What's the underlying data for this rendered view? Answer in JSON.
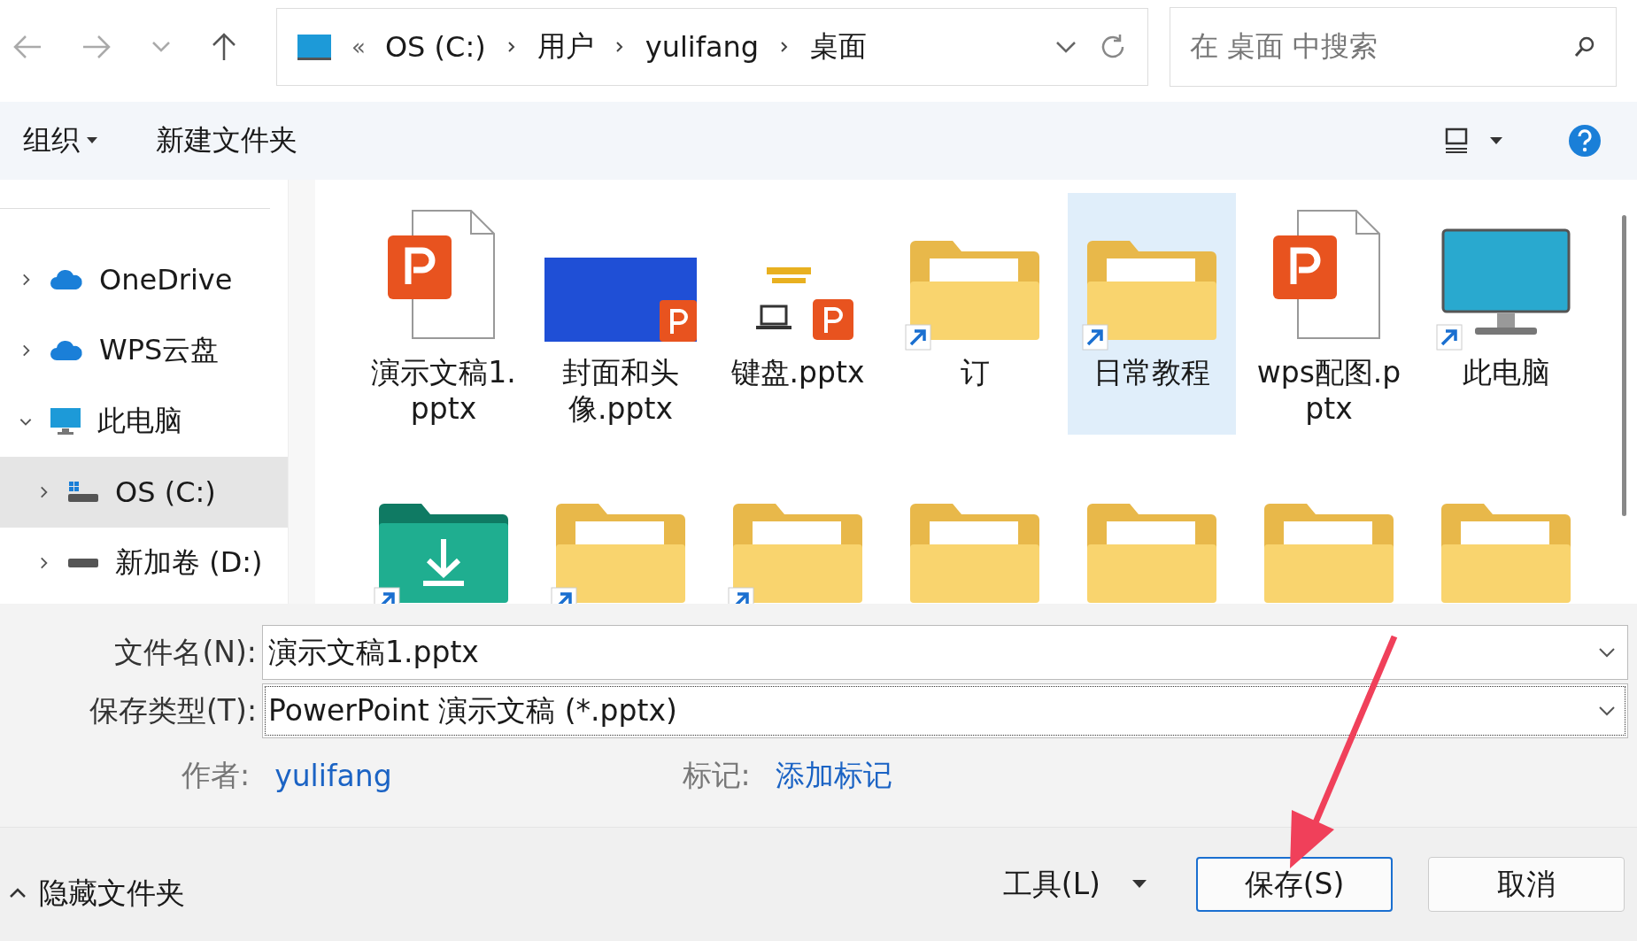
{
  "address_bar": {
    "overflow": "«",
    "segments": [
      "OS (C:)",
      "用户",
      "yulifang",
      "桌面"
    ]
  },
  "search": {
    "placeholder": "在 桌面 中搜索"
  },
  "toolbar": {
    "organize": "组织",
    "new_folder": "新建文件夹"
  },
  "sidebar": {
    "items": [
      {
        "name": "OneDrive",
        "kind": "cloud",
        "expanded": false,
        "selected": false
      },
      {
        "name": "WPS云盘",
        "kind": "cloud",
        "expanded": false,
        "selected": false
      },
      {
        "name": "此电脑",
        "kind": "pc",
        "expanded": true,
        "selected": false,
        "children": [
          {
            "name": "OS (C:)",
            "kind": "system-drive",
            "expanded": false,
            "selected": true
          },
          {
            "name": "新加卷 (D:)",
            "kind": "drive",
            "expanded": false,
            "selected": false
          }
        ]
      }
    ]
  },
  "files": [
    {
      "name": "演示文稿1.pptx",
      "kind": "pptx",
      "shortcut": false,
      "selected": false
    },
    {
      "name": "封面和头像.pptx",
      "kind": "slide-thumbnail",
      "shortcut": false,
      "selected": false
    },
    {
      "name": "键盘.pptx",
      "kind": "laptop-thumbnail",
      "shortcut": false,
      "selected": false
    },
    {
      "name": "订",
      "kind": "folder",
      "shortcut": true,
      "selected": false
    },
    {
      "name": "日常教程",
      "kind": "folder",
      "shortcut": true,
      "selected": true
    },
    {
      "name": "wps配图.pptx",
      "kind": "pptx",
      "shortcut": false,
      "selected": false
    },
    {
      "name": "此电脑",
      "kind": "monitor",
      "shortcut": true,
      "selected": false
    },
    {
      "kind": "download-folder",
      "shortcut": true,
      "selected": false
    },
    {
      "kind": "folder",
      "shortcut": true,
      "selected": false
    },
    {
      "kind": "folder",
      "shortcut": true,
      "selected": false
    },
    {
      "kind": "folder",
      "shortcut": false,
      "selected": false
    },
    {
      "kind": "folder",
      "shortcut": false,
      "selected": false
    },
    {
      "kind": "folder",
      "shortcut": false,
      "selected": false
    },
    {
      "kind": "folder",
      "shortcut": false,
      "selected": false
    }
  ],
  "form": {
    "file_name_label": "文件名(N):",
    "file_name": "演示文稿1.pptx",
    "file_type_label": "保存类型(T):",
    "file_type": "PowerPoint 演示文稿 (*.pptx)",
    "author_label": "作者:",
    "author": "yulifang",
    "tags_label": "标记:",
    "tags": "添加标记"
  },
  "footer": {
    "hide_folders": "隐藏文件夹",
    "tools": "工具(L)",
    "save": "保存(S)",
    "cancel": "取消"
  }
}
